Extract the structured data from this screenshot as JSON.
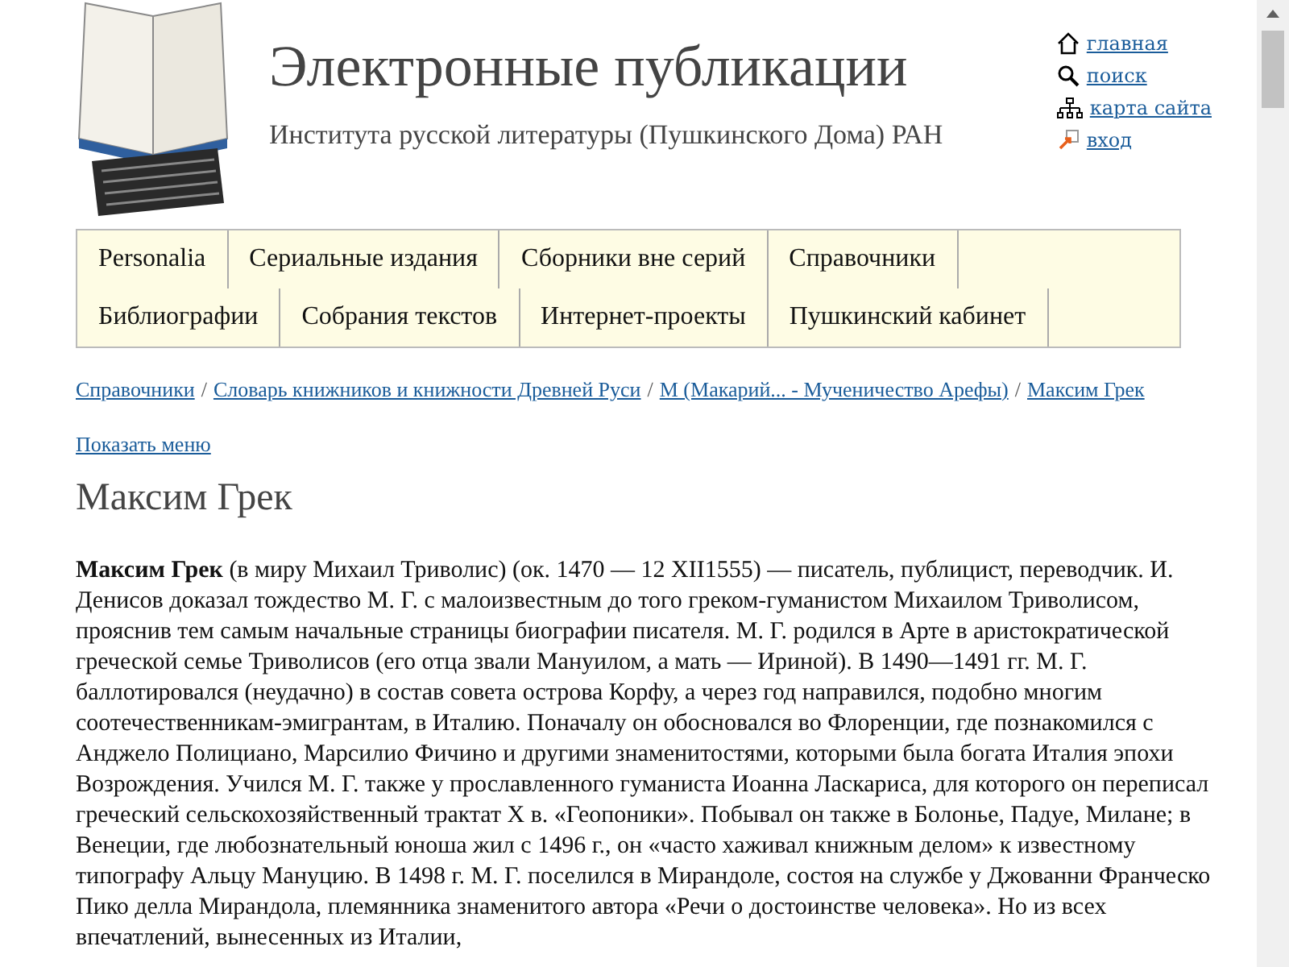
{
  "header": {
    "title": "Электронные публикации",
    "subtitle": "Института русской литературы (Пушкинского Дома) РАН",
    "links": [
      "главная",
      "поиск",
      "карта сайта",
      "вход"
    ]
  },
  "breadcrumb_separator": "/",
  "menu": [
    [
      "Personalia",
      "Сериальные издания",
      "Сборники вне серий",
      "Справочники"
    ],
    [
      "Библиографии",
      "Собрания текстов",
      "Интернет-проекты",
      "Пушкинский кабинет"
    ]
  ],
  "breadcrumbs": [
    "Справочники",
    "Словарь книжников и книжности Древней Руси",
    "М (Макарий... - Мученичество Арефы)",
    "Максим Грек"
  ],
  "show_menu": "Показать меню",
  "heading": "Максим Грек",
  "paragraph": "**Максим Грек** (в миру Михаил Триволис) (ок. 1470 — 12 XII1555) — писатель, публицист, переводчик. И. Денисов доказал тождество М. Г. с малоизвестным до того греком-гуманистом Михаилом Триволисом, прояснив тем самым начальные страницы биографии писателя. М. Г. родился в Арте в аристократической греческой семье Триволисов (его отца звали Мануилом, а мать — Ириной). В 1490—1491 гг. М. Г. баллотировался (неудачно) в состав совета острова Корфу, а через год направился, подобно многим соотечественникам-эмигрантам, в Италию. Поначалу он обосновался во Флоренции, где познакомился с Анджело Полициано, Марсилио Фичино и другими знаменитостями, которыми была богата Италия эпохи Возрождения. Учился М. Г. также у прославленного гуманиста Иоанна Ласкариса, для которого он переписал греческий сельскохозяйственный трактат X в. «Геопоники». Побывал он также в Болонье, Падуе, Милане; в Венеции, где любознательный юноша жил с 1496 г., он «часто хаживал книжным делом» к известному типографу Альцу Мануцию. В 1498 г. М. Г. поселился в Мирандоле, состоя на службе у Джованни Франческо Пико делла Мирандола, племянника знаменитого автора «Речи о достоинстве человека». Но из всех впечатлений, вынесенных из Италии,"
}
